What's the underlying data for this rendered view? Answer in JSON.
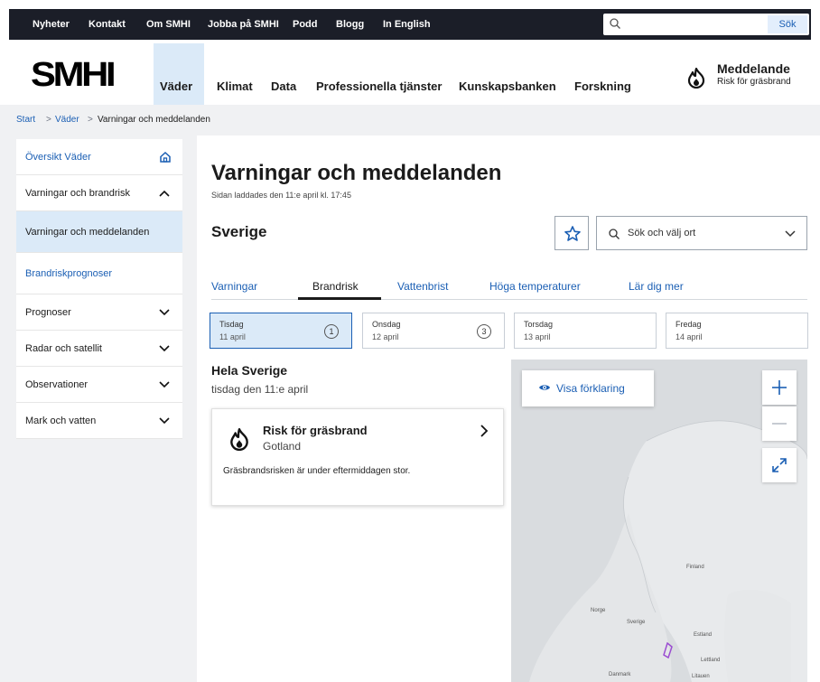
{
  "topbar": {
    "links": [
      "Nyheter",
      "Kontakt",
      "Om SMHI",
      "Jobba på SMHI",
      "Podd",
      "Blogg",
      "In English"
    ],
    "search_placeholder": "",
    "search_button": "Sök"
  },
  "header": {
    "logo": "SMHI",
    "nav": [
      "Väder",
      "Klimat",
      "Data",
      "Professionella tjänster",
      "Kunskapsbanken",
      "Forskning"
    ],
    "notice_title": "Meddelande",
    "notice_sub": "Risk för gräsbrand"
  },
  "breadcrumb": [
    "Start",
    "Väder",
    "Varningar och meddelanden"
  ],
  "sidebar": {
    "items": [
      {
        "label": "Översikt Väder"
      },
      {
        "label": "Varningar och brandrisk"
      },
      {
        "label": "Varningar och meddelanden"
      },
      {
        "label": "Brandriskprognoser"
      },
      {
        "label": "Prognoser"
      },
      {
        "label": "Radar och satellit"
      },
      {
        "label": "Observationer"
      },
      {
        "label": "Mark och vatten"
      }
    ]
  },
  "main": {
    "title": "Varningar och meddelanden",
    "loaded": "Sidan laddades den 11:e april kl. 17:45",
    "region_heading": "Sverige",
    "place_placeholder": "Sök och välj ort",
    "tabs": [
      "Varningar",
      "Brandrisk",
      "Vattenbrist",
      "Höga temperaturer",
      "Lär dig mer"
    ],
    "days": [
      {
        "name": "Tisdag",
        "date": "11 april",
        "count": "1"
      },
      {
        "name": "Onsdag",
        "date": "12 april",
        "count": "3"
      },
      {
        "name": "Torsdag",
        "date": "13 april",
        "count": ""
      },
      {
        "name": "Fredag",
        "date": "14 april",
        "count": ""
      }
    ],
    "region": "Hela Sverige",
    "region_date": "tisdag den 11:e april",
    "warning": {
      "title": "Risk för gräsbrand",
      "area": "Gotland",
      "description": "Gräsbrandsrisken är under eftermiddagen stor."
    }
  },
  "map": {
    "legend_button": "Visa förklaring",
    "labels": [
      "Finland",
      "Norge",
      "Sverige",
      "Estland",
      "Lettland",
      "Danmark",
      "Litauen"
    ]
  },
  "colors": {
    "accent": "#1b5fb4",
    "topbar": "#1b1e28",
    "active_bg": "#dbeaf8",
    "sidebar_bg": "#f0f1f3",
    "map_bg": "#d9dcdf",
    "warning_region": "#9b4dd1"
  }
}
